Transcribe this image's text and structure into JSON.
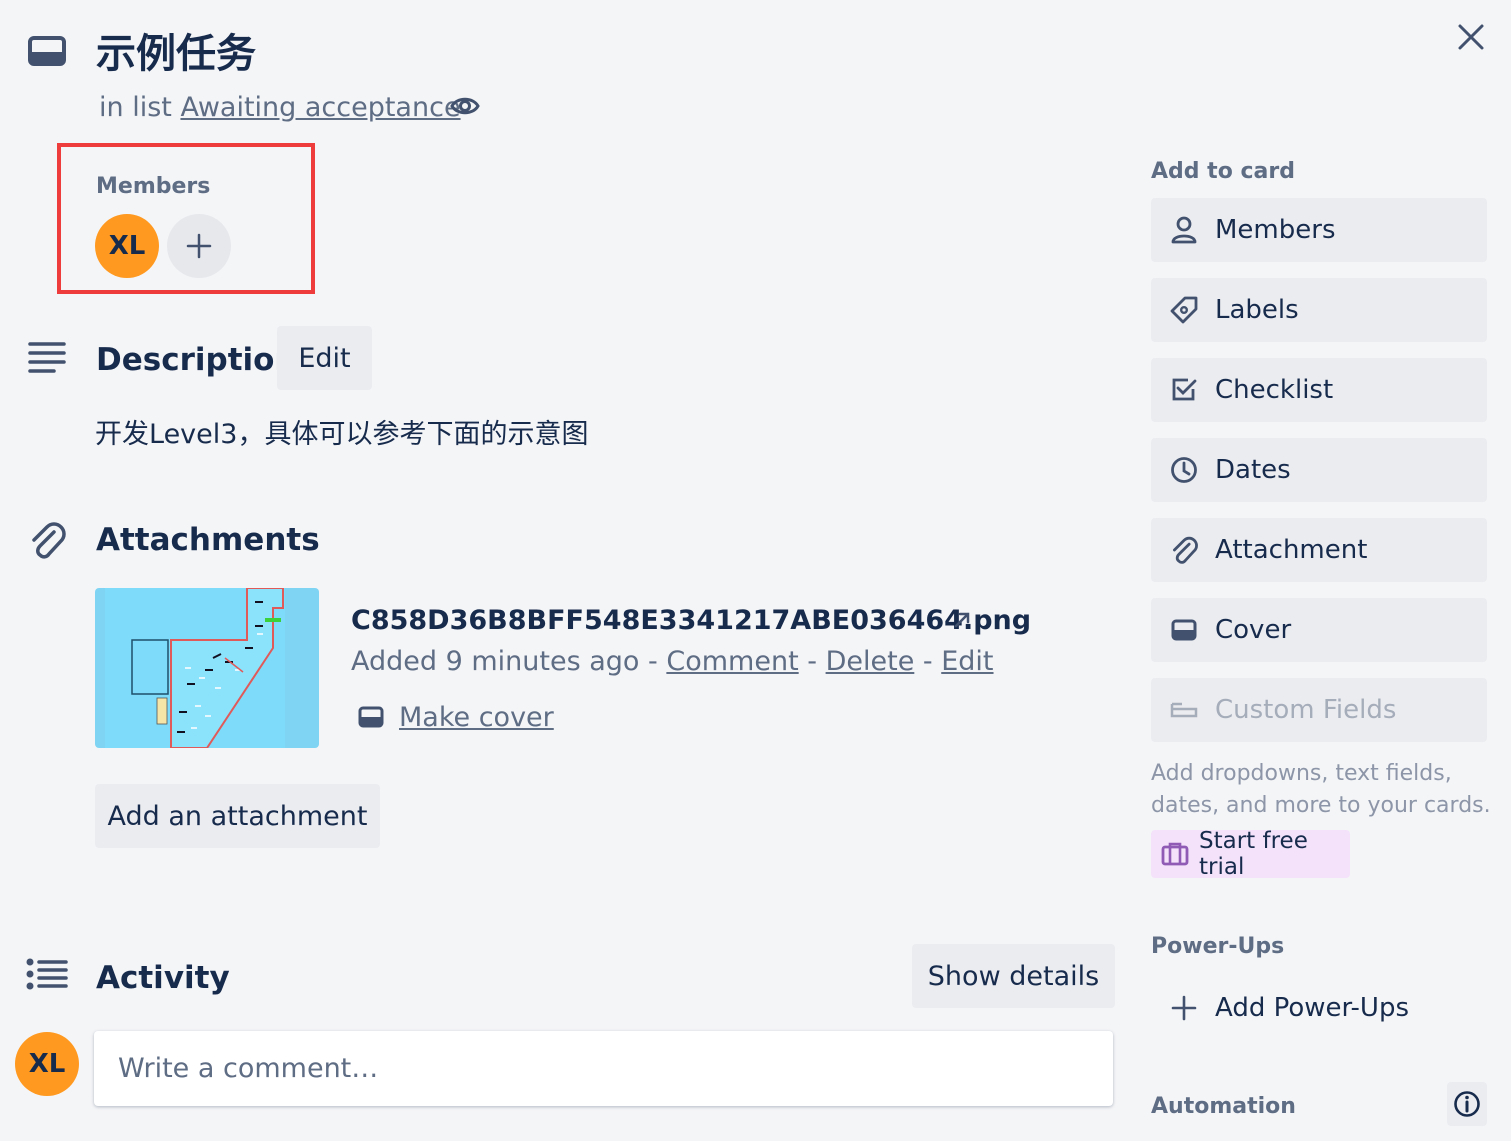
{
  "card": {
    "title": "示例任务",
    "list_prefix": "in list ",
    "list_name": "Awaiting acceptance"
  },
  "members": {
    "label": "Members",
    "avatars": [
      {
        "initials": "XL",
        "color": "#ff991f"
      }
    ]
  },
  "description": {
    "title": "Description",
    "edit_label": "Edit",
    "text": "开发Level3，具体可以参考下面的示意图"
  },
  "attachments": {
    "title": "Attachments",
    "file": {
      "name": "C858D36B8BFF548E3341217ABE036464.png",
      "added": "Added 9 minutes ago",
      "sep": " - ",
      "comment": "Comment",
      "delete": "Delete",
      "edit": "Edit",
      "make_cover": "Make cover"
    },
    "add_label": "Add an attachment"
  },
  "activity": {
    "title": "Activity",
    "show_details": "Show details",
    "comment_placeholder": "Write a comment…",
    "avatar_initials": "XL"
  },
  "sidebar": {
    "add_to_card": "Add to card",
    "buttons": [
      {
        "label": "Members",
        "icon": "person-icon"
      },
      {
        "label": "Labels",
        "icon": "tag-icon"
      },
      {
        "label": "Checklist",
        "icon": "checkbox-icon"
      },
      {
        "label": "Dates",
        "icon": "clock-icon"
      },
      {
        "label": "Attachment",
        "icon": "paperclip-icon"
      },
      {
        "label": "Cover",
        "icon": "cover-icon"
      },
      {
        "label": "Custom Fields",
        "icon": "custom-fields-icon",
        "disabled": true
      }
    ],
    "custom_fields_desc": "Add dropdowns, text fields, dates, and more to your cards.",
    "start_trial": "Start free trial",
    "powerups_heading": "Power-Ups",
    "add_powerups": "Add Power-Ups",
    "automation_heading": "Automation"
  },
  "colors": {
    "accent_avatar": "#ff991f",
    "highlight_border": "#ee3b3b",
    "trial_bg": "#f3e2fa",
    "trial_icon": "#8f5bb5"
  }
}
